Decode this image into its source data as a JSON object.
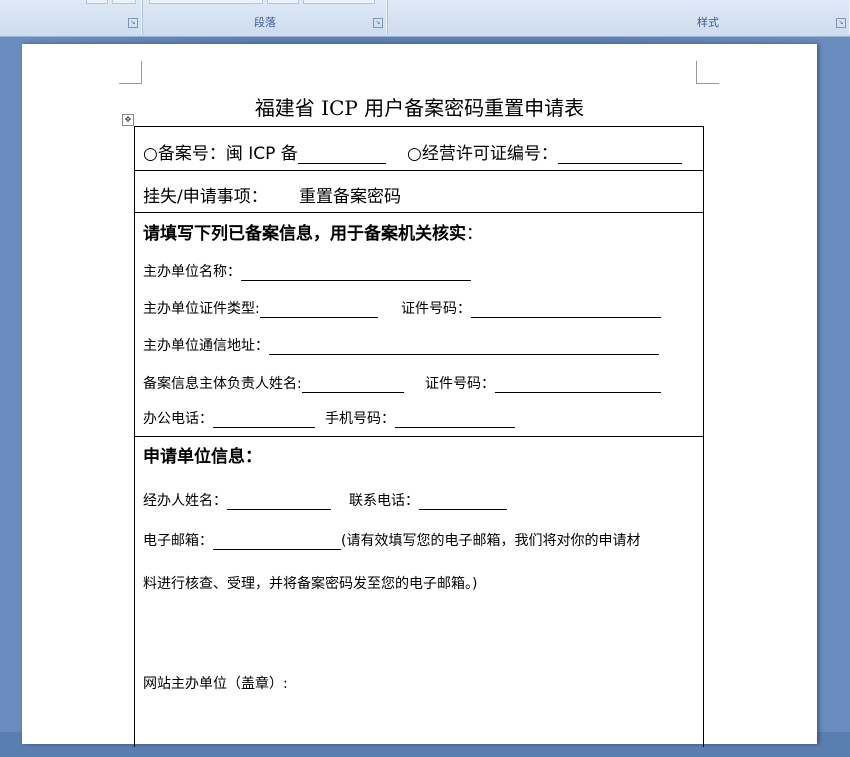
{
  "ribbon": {
    "paragraph_group": "段落",
    "styles_group": "样式"
  },
  "document": {
    "title": "福建省 ICP 用户备案密码重置申请表",
    "record_no_label": "○备案号：闽 ICP 备",
    "license_no_label": "○经营许可证编号：",
    "matter_label": "挂失/申请事项：",
    "matter_value": "重置备案密码",
    "section1_heading": "请填写下列已备案信息，用于备案机关核实",
    "section1_colon": "：",
    "host_unit_name": "主办单位名称：",
    "host_cert_type": "主办单位证件类型:",
    "cert_no_1": "证件号码：",
    "host_address": "主办单位通信地址：",
    "owner_name": "备案信息主体负责人姓名:",
    "cert_no_2": "证件号码：",
    "office_phone": "办公电话：",
    "mobile": "手机号码：",
    "section2_heading": "申请单位信息：",
    "handler_name": "经办人姓名：",
    "contact_phone": "联系电话：",
    "email_label": "电子邮箱：",
    "email_note_1": "(请有效填写您的电子邮箱，我们将对你的申请材",
    "email_note_2": "料进行核查、受理，并将备案密码发至您的电子邮箱。)",
    "seal_label": "网站主办单位（盖章）:"
  }
}
